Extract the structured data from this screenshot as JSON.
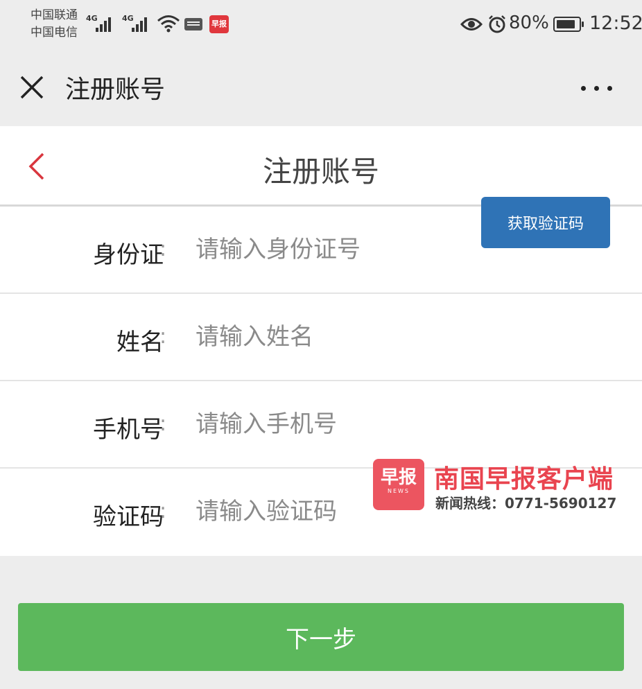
{
  "status_bar": {
    "carrier_1": "中国联通",
    "carrier_2": "中国电信",
    "network_1": "4G",
    "network_2": "4G",
    "app_badge": "早报",
    "battery_percent": "80%",
    "time": "12:52",
    "icons": [
      "signal-icon",
      "wifi-icon",
      "keyboard-icon",
      "eye-icon",
      "alarm-icon",
      "battery-icon"
    ]
  },
  "title_bar": {
    "title": "注册账号",
    "close_icon": "close-icon",
    "more_icon": "more-icon"
  },
  "page_header": {
    "title": "注册账号",
    "back_icon": "chevron-left-icon",
    "back_color": "#d9363e"
  },
  "form": {
    "fields": [
      {
        "label": "身份证",
        "colon": ":",
        "placeholder": "请输入身份证号",
        "value": ""
      },
      {
        "label": "姓名",
        "colon": ":",
        "placeholder": "请输入姓名",
        "value": ""
      },
      {
        "label": "手机号",
        "colon": ":",
        "placeholder": "请输入手机号",
        "value": ""
      },
      {
        "label": "验证码",
        "colon": ":",
        "placeholder": "请输入验证码",
        "value": ""
      }
    ],
    "sms_button_label": "获取验证码",
    "sms_button_color": "#2f73b6"
  },
  "watermark": {
    "logo_text": "早报",
    "logo_sub": "NEWS",
    "name": "南国早报客户端",
    "hotline": "新闻热线：0771-5690127"
  },
  "next_button": {
    "label": "下一步",
    "color": "#5cb85c"
  }
}
